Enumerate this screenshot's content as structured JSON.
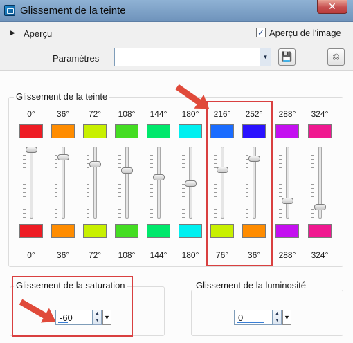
{
  "window": {
    "title": "Glissement de la teinte",
    "close_glyph": "✕"
  },
  "top": {
    "expander": "▶",
    "preview_label": "Aperçu",
    "image_preview_checkbox": {
      "label": "Aperçu de l'image",
      "checked": true,
      "glyph": "✓"
    },
    "params_label": "Paramètres",
    "preset_value": "",
    "dropdown_glyph": "▼",
    "save_icon": "floppy-disk-icon",
    "save_glyph": "💾",
    "reset_icon": "reset-icon",
    "reset_glyph": "⎌"
  },
  "hue_group": {
    "title": "Glissement de la teinte",
    "channels": [
      {
        "from": "0°",
        "to": "0°",
        "from_color": "#ee1c24",
        "to_color": "#ee1c24",
        "level": 1.0
      },
      {
        "from": "36°",
        "to": "36°",
        "from_color": "#ff8c00",
        "to_color": "#ff8c00",
        "level": 0.88
      },
      {
        "from": "72°",
        "to": "72°",
        "from_color": "#c8f000",
        "to_color": "#c8f000",
        "level": 0.78
      },
      {
        "from": "108°",
        "to": "108°",
        "from_color": "#44dd22",
        "to_color": "#44dd22",
        "level": 0.68
      },
      {
        "from": "144°",
        "to": "144°",
        "from_color": "#00e86c",
        "to_color": "#00e86c",
        "level": 0.58
      },
      {
        "from": "180°",
        "to": "180°",
        "from_color": "#00f0f0",
        "to_color": "#00f0f0",
        "level": 0.48
      },
      {
        "from": "216°",
        "to": "76°",
        "from_color": "#1a6cff",
        "to_color": "#c8f000",
        "level": 0.69
      },
      {
        "from": "252°",
        "to": "36°",
        "from_color": "#2a12ff",
        "to_color": "#ff8c00",
        "level": 0.86
      },
      {
        "from": "288°",
        "to": "288°",
        "from_color": "#c410f0",
        "to_color": "#c410f0",
        "level": 0.22
      },
      {
        "from": "324°",
        "to": "324°",
        "from_color": "#f01890",
        "to_color": "#f01890",
        "level": 0.13
      }
    ]
  },
  "saturation": {
    "title": "Glissement de la saturation",
    "value": "-60",
    "spin_up": "▲",
    "spin_down": "▼",
    "dropdown_glyph": "▼"
  },
  "luminosity": {
    "title": "Glissement de la luminosité",
    "value": "0",
    "spin_up": "▲",
    "spin_down": "▼",
    "dropdown_glyph": "▼"
  },
  "colors": {
    "highlight_red": "#d94040",
    "annotation_arrow": "#e04a3a"
  }
}
